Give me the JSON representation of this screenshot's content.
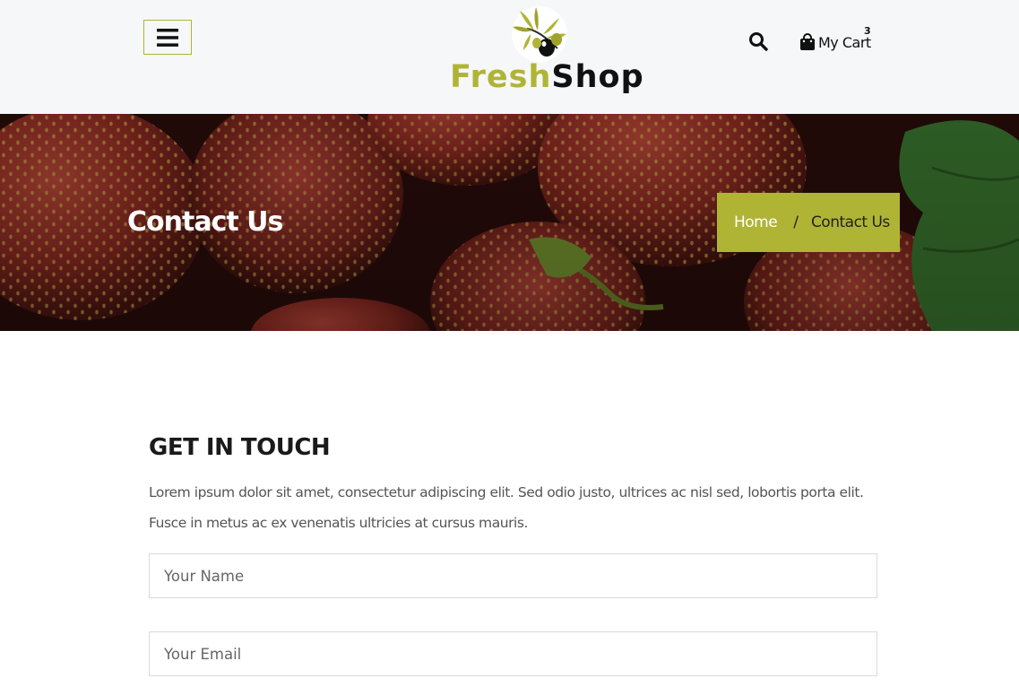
{
  "header": {
    "menu_icon": "hamburger-menu-icon",
    "logo": {
      "part1": "Fresh",
      "part2": "Shop"
    },
    "search_icon": "search-icon",
    "cart": {
      "icon": "shopping-bag-icon",
      "label": "My Cart",
      "count": "3"
    }
  },
  "banner": {
    "title": "Contact Us",
    "breadcrumb": {
      "home": "Home",
      "separator": "/",
      "current": "Contact Us"
    }
  },
  "contact": {
    "title": "GET IN TOUCH",
    "description": "Lorem ipsum dolor sit amet, consectetur adipiscing elit. Sed odio justo, ultrices ac nisl sed, lobortis porta elit. Fusce in metus ac ex venenatis ultricies at cursus mauris.",
    "name_placeholder": "Your Name",
    "email_placeholder": "Your Email"
  },
  "colors": {
    "accent": "#b0b435",
    "header_bg": "#f5f7f9",
    "text_dark": "#1a1a1a"
  }
}
